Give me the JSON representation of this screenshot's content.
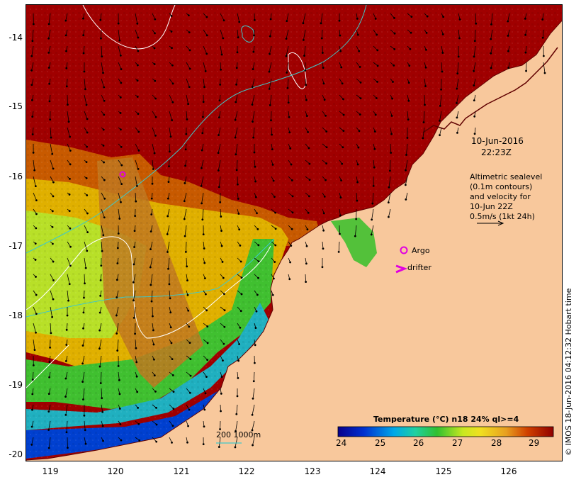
{
  "map": {
    "date_label": "10-Jun-2016",
    "time_label": "22:23Z",
    "legend_text": [
      "Altimetric sealevel",
      "(0.1m contours)",
      "and velocity for",
      "10-Jun 22Z",
      "0.5m/s (1kt 24h)"
    ],
    "argo_label": "Argo",
    "drifter_label": "drifter",
    "depth_label": "200  1000m",
    "colorbar_title": "Temperature (°C) n18 24% ql>=4",
    "colorbar_ticks": [
      "24",
      "25",
      "26",
      "27",
      "28",
      "29"
    ],
    "lat_ticks": [
      "-14",
      "-15",
      "-16",
      "-17",
      "-18",
      "-19",
      "-20"
    ],
    "lon_ticks": [
      "119",
      "120",
      "121",
      "122",
      "123",
      "124",
      "125",
      "126"
    ],
    "timestamp": "© IMOS 18-Jun-2016 04:12:32 Hobart time",
    "colors": {
      "land": "#f8c89c",
      "warm": "#a00000",
      "argo": "#e000e0",
      "contour_white": "#ffffff",
      "contour_cyan": "#40c8c8",
      "background": "#ffffff"
    }
  }
}
